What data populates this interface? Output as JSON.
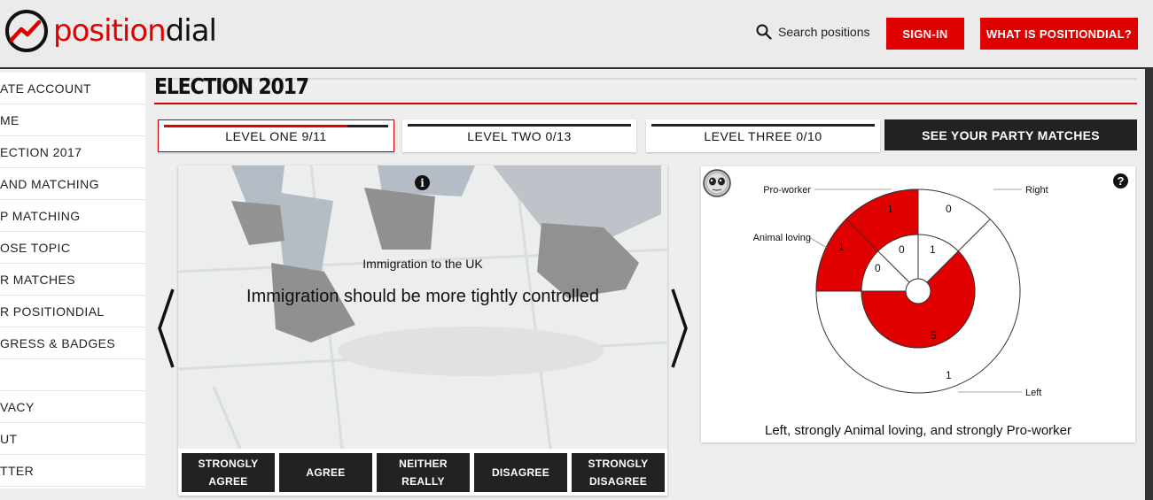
{
  "header": {
    "logo": {
      "part_red": "position",
      "part_dark": "dial"
    },
    "search_label": "Search positions",
    "signin_label": "SIGN-IN",
    "what_label": "WHAT IS POSITIONDIAL?"
  },
  "sidebar": {
    "items": [
      "ATE ACCOUNT",
      "ME",
      "ECTION 2017",
      "AND MATCHING",
      "P MATCHING",
      "OSE TOPIC",
      "R MATCHES",
      "R POSITIONDIAL",
      "GRESS & BADGES",
      "",
      "VACY",
      "UT",
      "TTER"
    ]
  },
  "main": {
    "title": "ELECTION 2017",
    "levels": [
      {
        "label": "LEVEL ONE 9/11",
        "progress": 0.818
      },
      {
        "label": "LEVEL TWO 0/13",
        "progress": 0
      },
      {
        "label": "LEVEL THREE 0/10",
        "progress": 0
      }
    ],
    "party_button": "SEE YOUR PARTY MATCHES"
  },
  "question": {
    "topic": "Immigration to the UK",
    "text": "Immigration should be more tightly controlled",
    "answers": [
      {
        "line1": "STRONGLY",
        "line2": "AGREE"
      },
      {
        "line1": "AGREE",
        "line2": ""
      },
      {
        "line1": "NEITHER",
        "line2": "REALLY"
      },
      {
        "line1": "DISAGREE",
        "line2": ""
      },
      {
        "line1": "STRONGLY",
        "line2": "DISAGREE"
      }
    ]
  },
  "dial": {
    "labels": {
      "pro_worker": "Pro-worker",
      "right": "Right",
      "animal_loving": "Animal loving",
      "left": "Left"
    },
    "summary": "Left, strongly Animal loving, and strongly Pro-worker",
    "values": {
      "outer_proworker": "1",
      "outer_right": "0",
      "outer_animal": "1",
      "outer_left": "1",
      "inner_animal": "0",
      "inner_proworker": "0",
      "inner_right": "1",
      "inner_left": "5"
    },
    "accent": "#e00000"
  },
  "colors": {
    "brand": "#e00000",
    "dark": "#222222"
  }
}
